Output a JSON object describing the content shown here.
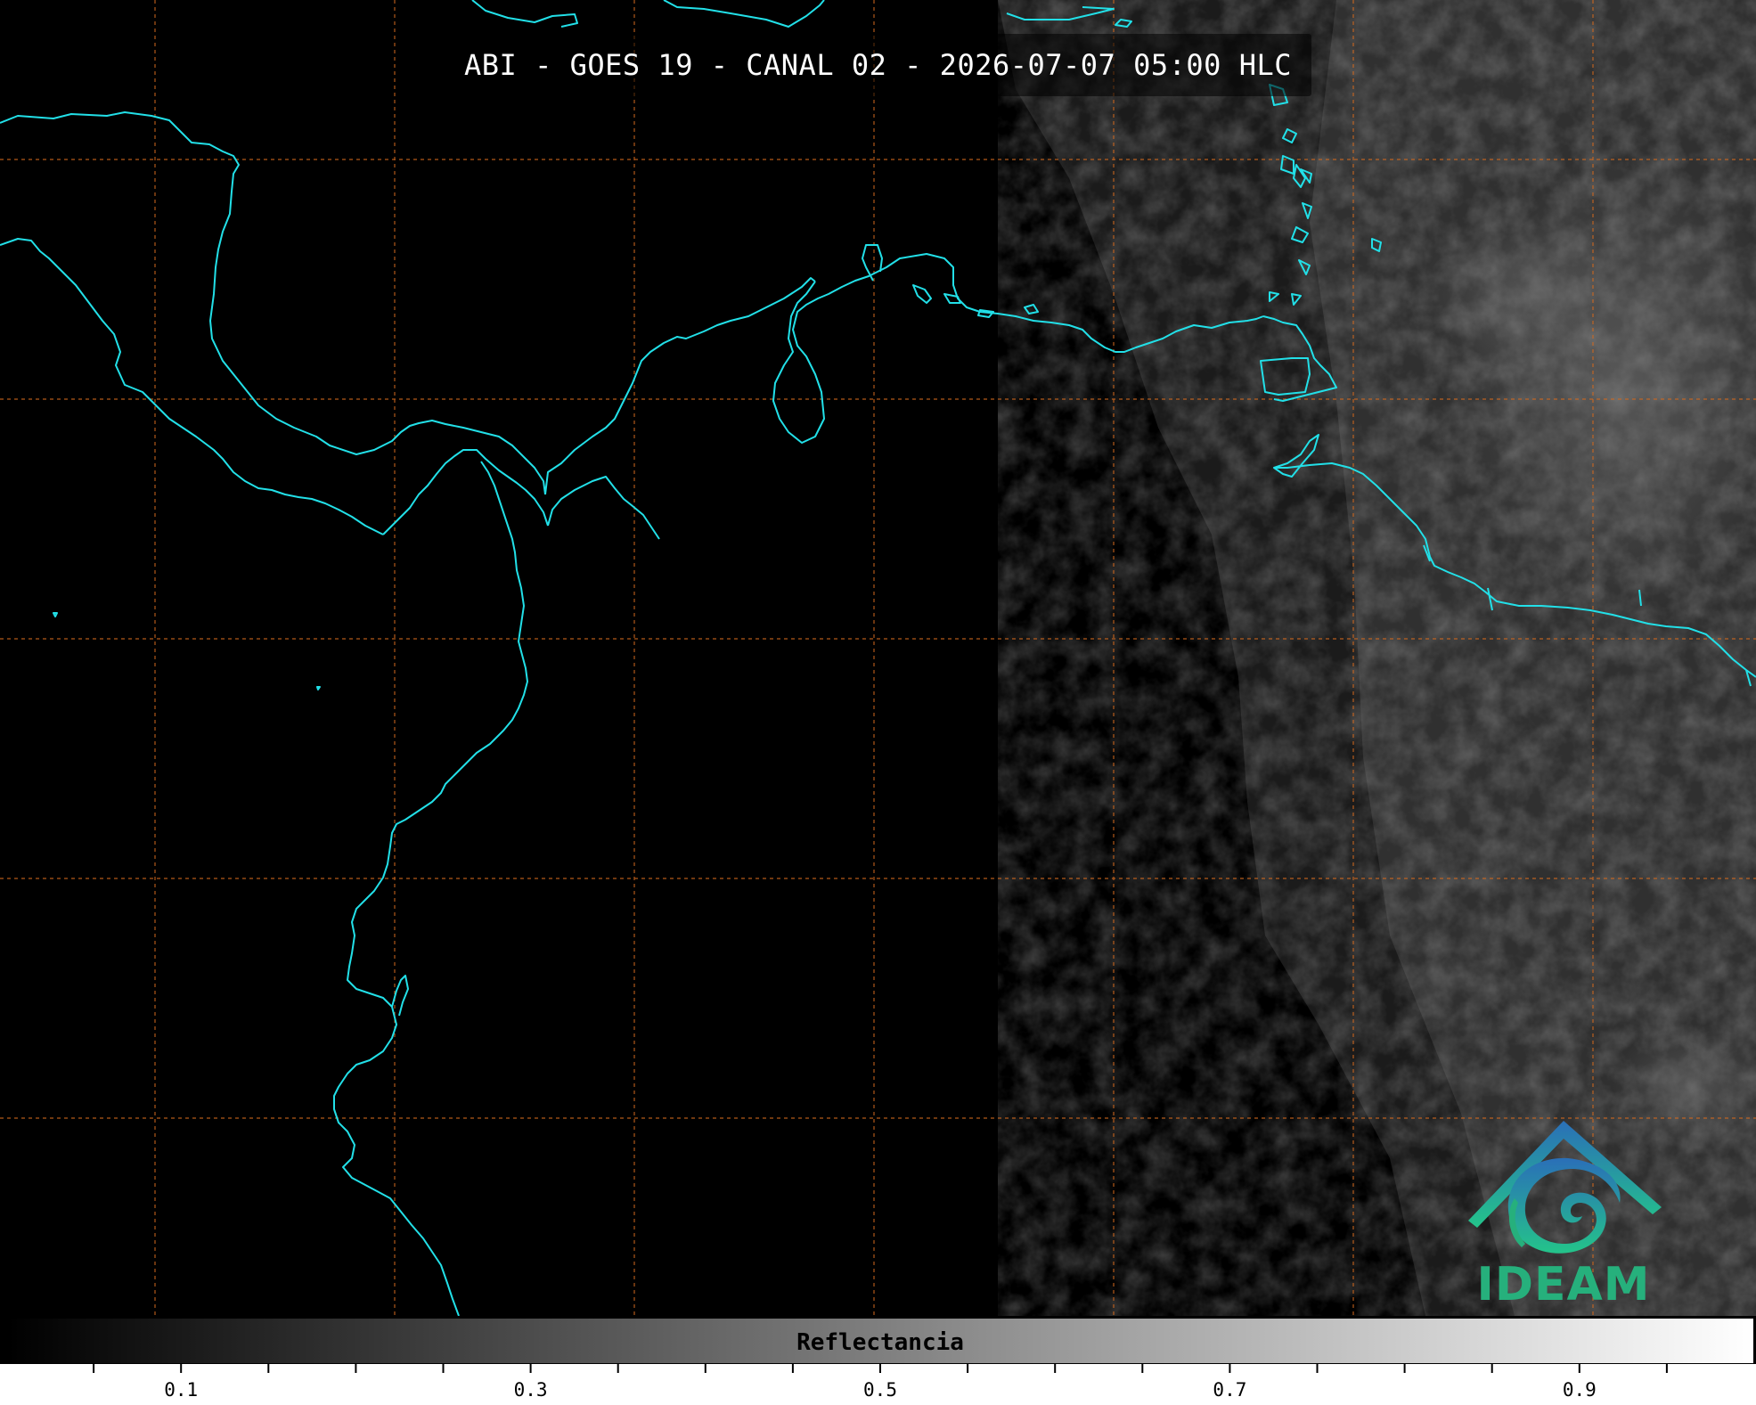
{
  "title": "ABI - GOES 19 - CANAL 02 - 2026-07-07 05:00 HLC",
  "colorbar": {
    "label": "Reflectancia",
    "min": 0.0,
    "max": 1.0,
    "colormap": [
      "#000000",
      "#ffffff"
    ],
    "tick_labels": [
      "0.1",
      "0.3",
      "0.5",
      "0.7",
      "0.9"
    ],
    "major_ticks": [
      0.1,
      0.3,
      0.5,
      0.7,
      0.9
    ],
    "minor_step": 0.05
  },
  "logo": {
    "text": "IDEAM"
  },
  "map": {
    "coastline_color": "#22e0e8",
    "gridline_color": "#d2691e",
    "gridline_style": "dashed",
    "background": "night (dark)",
    "illuminated_region": "east"
  }
}
